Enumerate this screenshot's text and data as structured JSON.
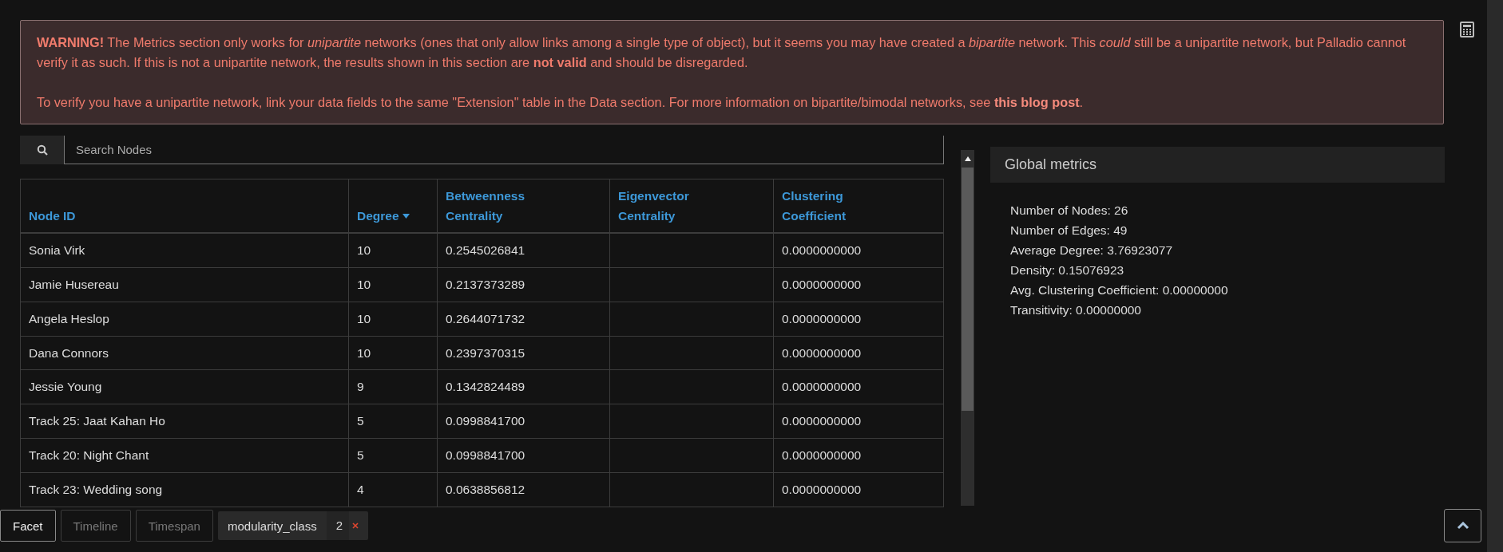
{
  "warning": {
    "paragraphs": [
      "**WARNING!** The Metrics section only works for *unipartite* networks (ones that only allow links among a single type of object), but it seems you may have created a *bipartite* network. This *could* still be a unipartite network, but Palladio cannot verify it as such. If this is not a unipartite network, the results shown in this section are **not valid** and should be disregarded.",
      "To verify you have a unipartite network, link your data fields to the same \"Extension\" table in the Data section. For more information on bipartite/bimodal networks, see "
    ],
    "link": "this blog post",
    "link_suffix": "."
  },
  "search": {
    "placeholder": "Search Nodes"
  },
  "table": {
    "columns": [
      {
        "label": "Node ID",
        "sorted": false
      },
      {
        "label": "Degree",
        "sorted": true
      },
      {
        "label": "Betweenness Centrality",
        "sorted": false
      },
      {
        "label": "Eigenvector Centrality",
        "sorted": false
      },
      {
        "label": "Clustering Coefficient",
        "sorted": false
      }
    ],
    "rows": [
      [
        "Sonia Virk",
        "10",
        "0.2545026841",
        "",
        "0.0000000000"
      ],
      [
        "Jamie Husereau",
        "10",
        "0.2137373289",
        "",
        "0.0000000000"
      ],
      [
        "Angela Heslop",
        "10",
        "0.2644071732",
        "",
        "0.0000000000"
      ],
      [
        "Dana Connors",
        "10",
        "0.2397370315",
        "",
        "0.0000000000"
      ],
      [
        "Jessie Young",
        "9",
        "0.1342824489",
        "",
        "0.0000000000"
      ],
      [
        "Track 25: Jaat Kahan Ho",
        "5",
        "0.0998841700",
        "",
        "0.0000000000"
      ],
      [
        "Track 20: Night Chant",
        "5",
        "0.0998841700",
        "",
        "0.0000000000"
      ],
      [
        "Track 23: Wedding song",
        "4",
        "0.0638856812",
        "",
        "0.0000000000"
      ]
    ]
  },
  "global_metrics": {
    "title": "Global metrics",
    "lines": [
      "Number of Nodes: 26",
      "Number of Edges: 49",
      "Average Degree: 3.76923077",
      "Density: 0.15076923",
      "Avg. Clustering Coefficient: 0.00000000",
      "Transitivity: 0.00000000"
    ]
  },
  "bottom_tabs": [
    {
      "label": "Facet",
      "selected": true
    },
    {
      "label": "Timeline",
      "selected": false
    },
    {
      "label": "Timespan",
      "selected": false
    }
  ],
  "filter": {
    "field": "modularity_class",
    "value": "2"
  }
}
